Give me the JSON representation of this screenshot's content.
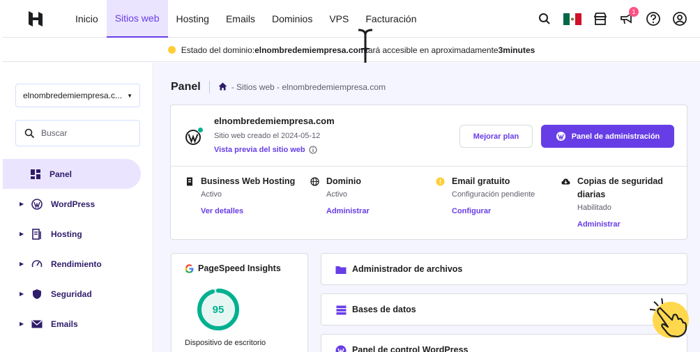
{
  "nav": {
    "links": [
      "Inicio",
      "Sitios web",
      "Hosting",
      "Emails",
      "Dominios",
      "VPS",
      "Facturación"
    ],
    "active_index": 1,
    "notification_count": "1",
    "icons": [
      "search-icon",
      "mexico-flag-icon",
      "store-icon",
      "megaphone-icon",
      "help-icon",
      "account-icon"
    ]
  },
  "status": {
    "prefix": "Estado del dominio: ",
    "domain": "elnombredemiempresa.com",
    "suffix_hidden": " estará accesible en aproximadamente ",
    "visible_suffix": " tará accesible en aproximadamente ",
    "eta": "3minutes"
  },
  "sidebar": {
    "domain_select": "elnombredemiempresa.c...",
    "search_placeholder": "Buscar",
    "items": [
      {
        "label": "Panel",
        "icon": "dashboard-icon"
      },
      {
        "label": "WordPress",
        "icon": "wordpress-icon"
      },
      {
        "label": "Hosting",
        "icon": "server-icon"
      },
      {
        "label": "Rendimiento",
        "icon": "speedometer-icon"
      },
      {
        "label": "Seguridad",
        "icon": "shield-icon"
      },
      {
        "label": "Emails",
        "icon": "envelope-icon"
      }
    ]
  },
  "main": {
    "title": "Panel",
    "breadcrumb": "- Sitios web - elnombredemiempresa.com",
    "site": {
      "name": "elnombredemiempresa.com",
      "created": "Sitio web creado el 2024-05-12",
      "preview": "Vista previa del sitio web",
      "upgrade_button": "Mejorar plan",
      "admin_button": "Panel de administración"
    },
    "features": [
      {
        "name": "Business Web Hosting",
        "status": "Activo",
        "link": "Ver detalles",
        "icon": "server-icon"
      },
      {
        "name": "Dominio",
        "status": "Activo",
        "link": "Administrar",
        "icon": "globe-icon"
      },
      {
        "name": "Email gratuito",
        "status": "Configuración pendiente",
        "link": "Configurar",
        "icon": "warning-dot-icon"
      },
      {
        "name": "Copias de seguridad diarias",
        "status": "Habilitado",
        "link": "Administrar",
        "icon": "cloud-icon"
      }
    ],
    "pagespeed": {
      "title": "PageSpeed Insights",
      "score": "95",
      "score_fraction": 0.95,
      "label": "Dispositivo de escritorio"
    },
    "tools": [
      {
        "label": "Administrador de archivos",
        "icon": "folder-icon"
      },
      {
        "label": "Bases de datos",
        "icon": "database-icon"
      },
      {
        "label": "Panel de control WordPress",
        "icon": "wordpress-icon"
      }
    ]
  },
  "colors": {
    "accent": "#673de6",
    "accent_light": "#ebe4ff",
    "success": "#00b090",
    "warning": "#ffcd35",
    "badge": "#fc5185"
  }
}
